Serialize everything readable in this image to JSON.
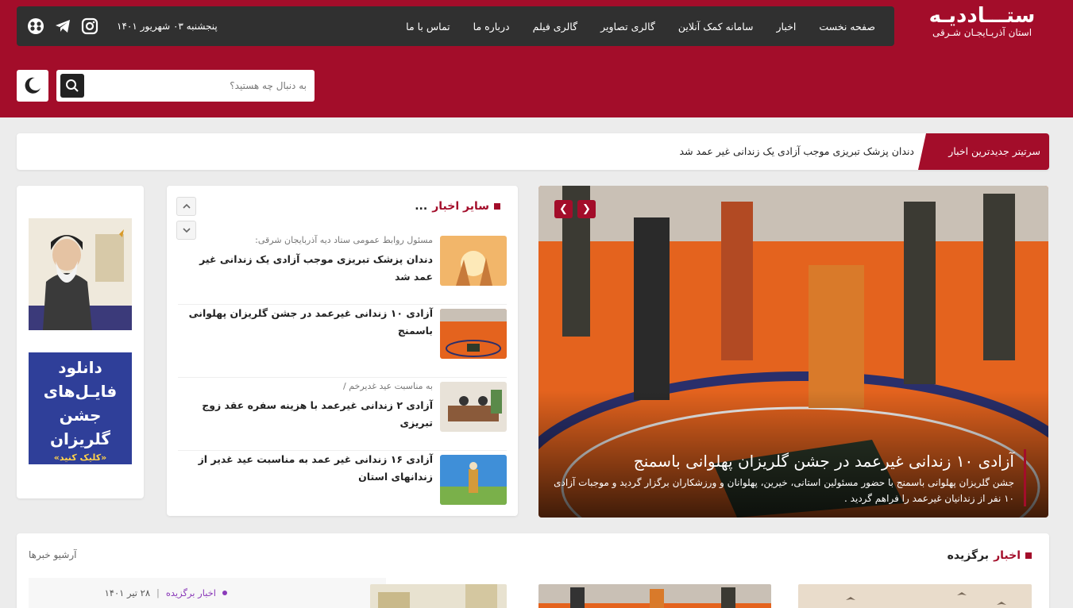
{
  "brand": {
    "title": "ستـــادديـه",
    "subtitle": "استان آذربـايجـان شـرقی"
  },
  "nav": {
    "items": [
      {
        "label": "صفحه نخست"
      },
      {
        "label": "اخبار"
      },
      {
        "label": "سامانه کمک آنلاین"
      },
      {
        "label": "گالری تصاویر"
      },
      {
        "label": "گالری فیلم"
      },
      {
        "label": "درباره ما"
      },
      {
        "label": "تماس با ما"
      }
    ],
    "date": "پنجشنبه ۰۳ شهریور ۱۴۰۱",
    "social": [
      "instagram-icon",
      "telegram-icon",
      "aparat-icon"
    ]
  },
  "search": {
    "placeholder": "به دنبال چه هستید؟"
  },
  "ticker": {
    "label": "سرتیتر جدیدترین اخبار",
    "headline": "دندان پزشک تبریزی موجب آزادی یک زندانی غیر عمد شد"
  },
  "slider": {
    "title": "آزادی ۱۰ زندانی غیرعمد در جشن گلریزان پهلوانی باسمنج",
    "description": "جشن گلریزان پهلوانی باسمنج با حضور مسئولین استانی، خیرین، پهلوانان و ورزشکاران برگزار گردید و موجبات آزادی ۱۰ نفر از زندانیان غیرعمد را فراهم گردید ."
  },
  "other_news": {
    "title": "سایر اخبار",
    "title_suffix": "...",
    "items": [
      {
        "meta": "مسئول روابط عمومی ستاد دیه آذربایجان شرقی:",
        "title": "دندان پزشک تبریزی موجب آزادی یک زندانی غیر عمد شد"
      },
      {
        "meta": "",
        "title": "آزادی ۱۰ زندانی غیرعمد در جشن گلریزان پهلوانی باسمنج"
      },
      {
        "meta": "به مناسبت عید غدیرخم /",
        "title": "آزادی ۲ زندانی غیرعمد با هزینه سفره عقد زوج تبریزی"
      },
      {
        "meta": "",
        "title": "آزادی ۱۶  زندانی غیر عمد به مناسبت عید غدیر از زندانهای استان"
      }
    ]
  },
  "ads": {
    "download": {
      "line1": "دانلود",
      "line2": "فایـل‌های",
      "line3": "جشن گلریزان",
      "line4": "«کلیک کنید»"
    }
  },
  "featured": {
    "title_accent": "اخبار",
    "title_rest": "برگزیده",
    "archive_label": "آرشیو خبرها",
    "row": {
      "category": "اخبار برگزیده",
      "separator": "|",
      "date": "۲۸ تیر ۱۴۰۱"
    }
  },
  "colors": {
    "brand": "#a30d2a",
    "navbar": "#303030",
    "accent_purple": "#8a3ab9"
  }
}
